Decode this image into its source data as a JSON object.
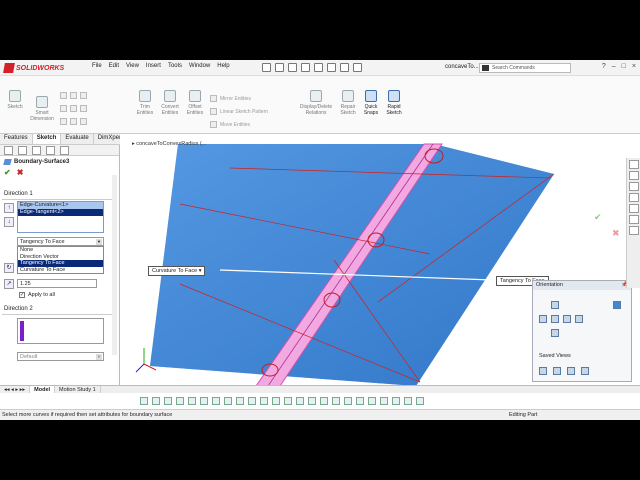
{
  "app": {
    "brand": "SOLIDWORKS",
    "doc_title": "concaveTo...",
    "search_placeholder": "Search Commands"
  },
  "menu": [
    "File",
    "Edit",
    "View",
    "Insert",
    "Tools",
    "Window",
    "Help"
  ],
  "ribbon": {
    "sketch": "Sketch",
    "smart_dimension": "Smart\nDimension",
    "trim": "Trim\nEntities",
    "convert": "Convert\nEntities",
    "offset": "Offset\nEntities",
    "mirror": "Mirror Entities",
    "linear_pattern": "Linear Sketch Pattern",
    "move": "Move Entities",
    "display_delete": "Display/Delete\nRelations",
    "repair": "Repair\nSketch",
    "quick_snaps": "Quick\nSnaps",
    "rapid_sketch": "Rapid\nSketch"
  },
  "tabs": [
    "Features",
    "Sketch",
    "Evaluate",
    "DimXpert"
  ],
  "feature": {
    "title": "Boundary-Surface3",
    "direction1": "Direction 1",
    "dir1_items": [
      "Edge-Curvature<1>",
      "Edge-Tangent<2>"
    ],
    "tangency_value": "Tangency To Face",
    "options": [
      "None",
      "Direction Vector",
      "Tangency To Face",
      "Curvature To Face"
    ],
    "number": "1.25",
    "apply_all": "Apply to all",
    "direction2": "Direction 2",
    "dir2_dropdown": "Default"
  },
  "graphics": {
    "breadcrumb": "concaveToConvexRadius  (...",
    "callout_left": "Curvature To Face",
    "callout_right": "Tangency To Face"
  },
  "orientation": {
    "title": "Orientation",
    "saved_views": "Saved Views"
  },
  "bottom_tabs": [
    "Model",
    "Motion Study 1"
  ],
  "status": {
    "message": "Select more curves if required then set attributes for boundary surface",
    "mode": "Editing Part"
  },
  "colors": {
    "surface": "#3b86d9",
    "strip": "#f2a0dc",
    "brand_red": "#d42127"
  }
}
